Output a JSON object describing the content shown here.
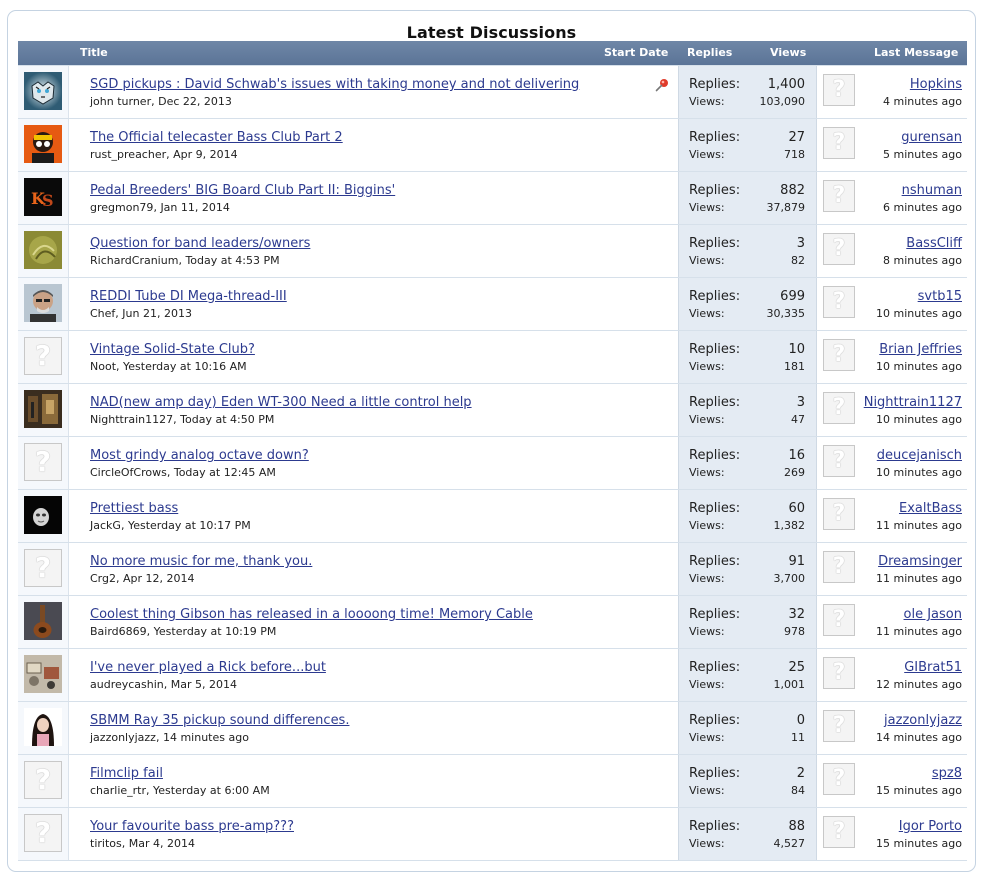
{
  "heading": "Latest Discussions",
  "columns": {
    "title": "Title",
    "start_date": "Start Date",
    "replies": "Replies",
    "views": "Views",
    "last_message": "Last Message"
  },
  "stat_labels": {
    "replies": "Replies:",
    "views": "Views:"
  },
  "threads": [
    {
      "title": "SGD pickups : David Schwab's issues with taking money and not delivering",
      "author": "john turner",
      "date": "Dec 22, 2013",
      "replies": "1,400",
      "views": "103,090",
      "last_user": "Hopkins",
      "last_time": "4 minutes ago",
      "avatar": "tiger",
      "pinned": true
    },
    {
      "title": "The Official telecaster Bass Club Part 2",
      "author": "rust_preacher",
      "date": "Apr 9, 2014",
      "replies": "27",
      "views": "718",
      "last_user": "gurensan",
      "last_time": "5 minutes ago",
      "avatar": "orange"
    },
    {
      "title": "Pedal Breeders' BIG Board Club Part II: Biggins'",
      "author": "gregmon79",
      "date": "Jan 11, 2014",
      "replies": "882",
      "views": "37,879",
      "last_user": "nshuman",
      "last_time": "6 minutes ago",
      "avatar": "ks-logo"
    },
    {
      "title": "Question for band leaders/owners",
      "author": "RichardCranium",
      "date": "Today at 4:53 PM",
      "replies": "3",
      "views": "82",
      "last_user": "BassCliff",
      "last_time": "8 minutes ago",
      "avatar": "olive"
    },
    {
      "title": "REDDI Tube DI Mega-thread-III",
      "author": "Chef",
      "date": "Jun 21, 2013",
      "replies": "699",
      "views": "30,335",
      "last_user": "svtb15",
      "last_time": "10 minutes ago",
      "avatar": "face"
    },
    {
      "title": "Vintage Solid-State Club?",
      "author": "Noot",
      "date": "Yesterday at 10:16 AM",
      "replies": "10",
      "views": "181",
      "last_user": "Brian Jeffries",
      "last_time": "10 minutes ago",
      "avatar": "placeholder"
    },
    {
      "title": "NAD(new amp day) Eden WT-300 Need a little control help",
      "author": "Nighttrain1127",
      "date": "Today at 4:50 PM",
      "replies": "3",
      "views": "47",
      "last_user": "Nighttrain1127",
      "last_time": "10 minutes ago",
      "avatar": "room"
    },
    {
      "title": "Most grindy analog octave down?",
      "author": "CircleOfCrows",
      "date": "Today at 12:45 AM",
      "replies": "16",
      "views": "269",
      "last_user": "deucejanisch",
      "last_time": "10 minutes ago",
      "avatar": "placeholder"
    },
    {
      "title": "Prettiest bass",
      "author": "JackG",
      "date": "Yesterday at 10:17 PM",
      "replies": "60",
      "views": "1,382",
      "last_user": "ExaltBass",
      "last_time": "11 minutes ago",
      "avatar": "mask"
    },
    {
      "title": "No more music for me, thank you.",
      "author": "Crg2",
      "date": "Apr 12, 2014",
      "replies": "91",
      "views": "3,700",
      "last_user": "Dreamsinger",
      "last_time": "11 minutes ago",
      "avatar": "placeholder"
    },
    {
      "title": "Coolest thing Gibson has released in a loooong time! Memory Cable",
      "author": "Baird6869",
      "date": "Yesterday at 10:19 PM",
      "replies": "32",
      "views": "978",
      "last_user": "ole Jason",
      "last_time": "11 minutes ago",
      "avatar": "guitar"
    },
    {
      "title": "I've never played a Rick before...but",
      "author": "audreycashin",
      "date": "Mar 5, 2014",
      "replies": "25",
      "views": "1,001",
      "last_user": "GIBrat51",
      "last_time": "12 minutes ago",
      "avatar": "pedals"
    },
    {
      "title": "SBMM Ray 35 pickup sound differences.",
      "author": "jazzonlyjazz",
      "date": "14 minutes ago",
      "replies": "0",
      "views": "11",
      "last_user": "jazzonlyjazz",
      "last_time": "14 minutes ago",
      "avatar": "woman"
    },
    {
      "title": "Filmclip fail",
      "author": "charlie_rtr",
      "date": "Yesterday at 6:00 AM",
      "replies": "2",
      "views": "84",
      "last_user": "spz8",
      "last_time": "15 minutes ago",
      "avatar": "placeholder"
    },
    {
      "title": "Your favourite bass pre-amp???",
      "author": "tiritos",
      "date": "Mar 4, 2014",
      "replies": "88",
      "views": "4,527",
      "last_user": "Igor Porto",
      "last_time": "15 minutes ago",
      "avatar": "placeholder"
    }
  ]
}
